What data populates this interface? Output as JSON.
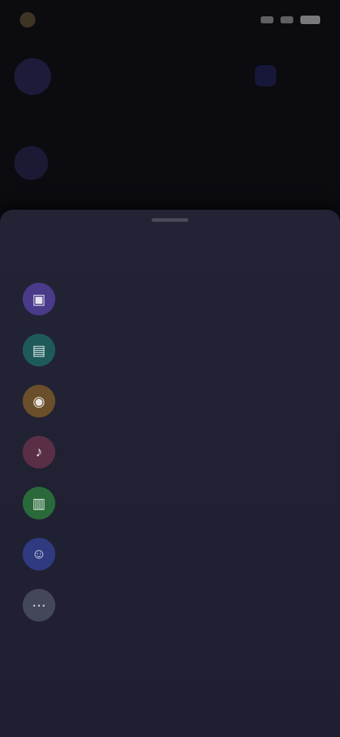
{
  "status_bar": {
    "time": "",
    "icons": [
      "signal-icon",
      "wifi-icon",
      "battery-icon"
    ]
  },
  "background_app": {
    "title": "",
    "row": {
      "title": "",
      "subtitle": ""
    }
  },
  "sheet": {
    "title": "",
    "items": [
      {
        "icon": "photo-icon",
        "glyph": "▣",
        "color": "#4a3a8a",
        "title": "",
        "subtitle": ""
      },
      {
        "icon": "document-icon",
        "glyph": "▤",
        "color": "#1f5a5a",
        "title": "",
        "subtitle": ""
      },
      {
        "icon": "location-icon",
        "glyph": "◉",
        "color": "#6b4f2a",
        "title": "",
        "subtitle": ""
      },
      {
        "icon": "music-icon",
        "glyph": "♪",
        "color": "#5a2f45",
        "title": "",
        "subtitle": ""
      },
      {
        "icon": "poll-icon",
        "glyph": "▥",
        "color": "#2a6a3a",
        "title": "",
        "subtitle": ""
      },
      {
        "icon": "contact-icon",
        "glyph": "☺",
        "color": "#2f3a80",
        "title": "",
        "subtitle": ""
      },
      {
        "icon": "more-icon",
        "glyph": "⋯",
        "color": "#44465a",
        "title": "",
        "subtitle": ""
      }
    ]
  },
  "colors": {
    "background": "#0b0b10",
    "sheet": "#232336"
  }
}
